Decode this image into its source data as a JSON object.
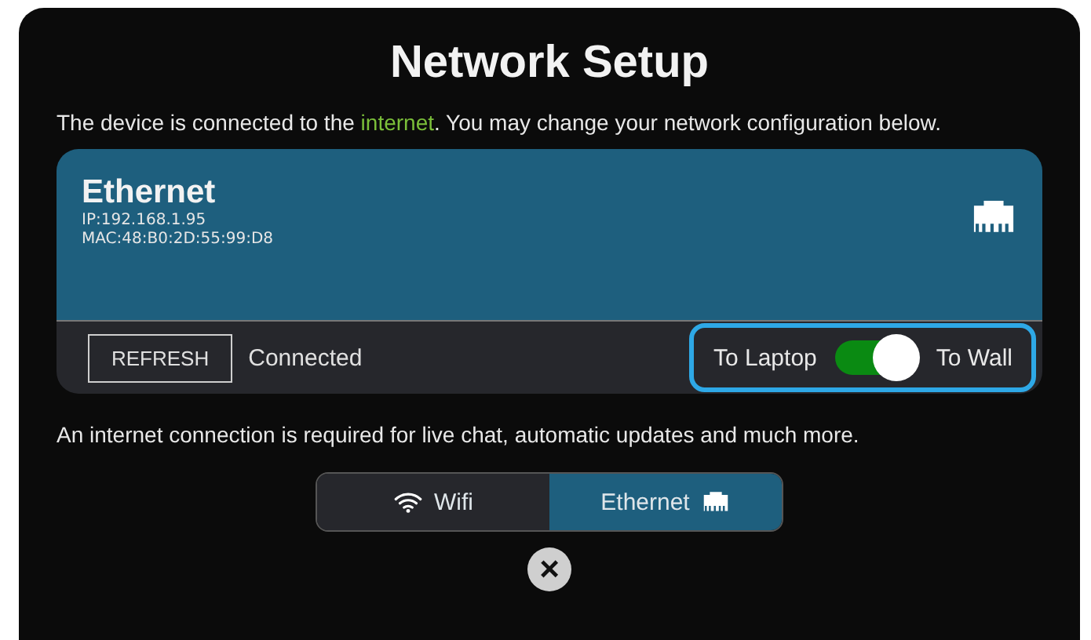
{
  "title": "Network Setup",
  "intro": {
    "before": "The device is connected to the ",
    "link": "internet",
    "after": ". You may change your network configuration below."
  },
  "connection": {
    "name": "Ethernet",
    "ip": "IP:192.168.1.95",
    "mac": "MAC:48:B0:2D:55:99:D8",
    "refresh_button": "REFRESH",
    "status": "Connected",
    "switch": {
      "left_label": "To Laptop",
      "right_label": "To Wall",
      "on": true,
      "focused": true
    }
  },
  "note": "An internet connection is required for live chat, automatic updates and much more.",
  "tabs": [
    {
      "label": "Wifi",
      "kind": "wifi",
      "selected": false
    },
    {
      "label": "Ethernet",
      "kind": "ethernet",
      "selected": true
    }
  ],
  "close_button": "×"
}
